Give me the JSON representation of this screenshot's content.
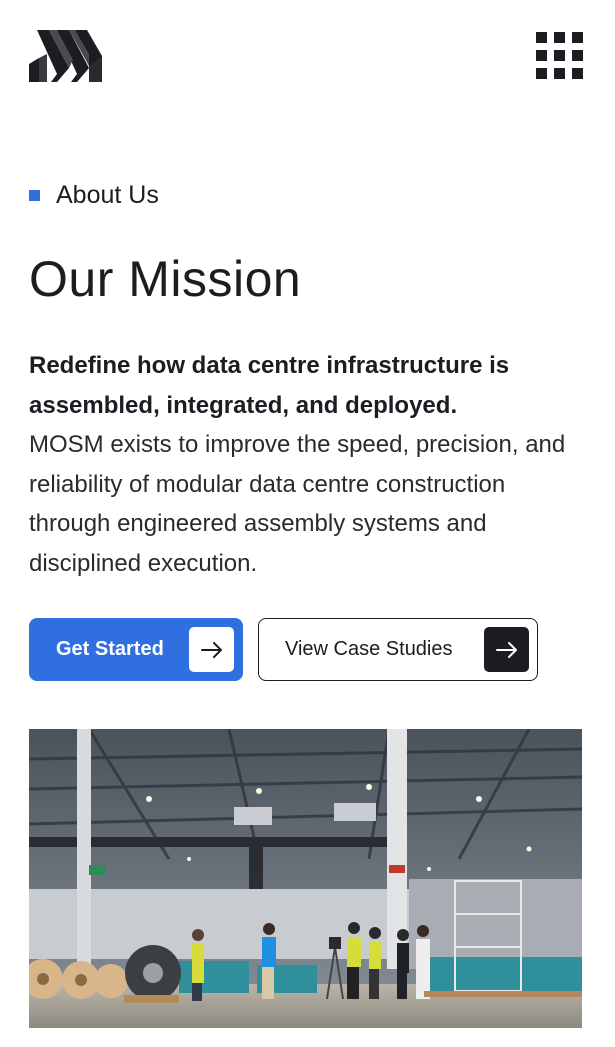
{
  "header": {
    "logo_name": "MOSM logo",
    "menu_icon": "grid-menu-icon"
  },
  "section": {
    "eyebrow": "About Us",
    "title": "Our Mission",
    "lead": "Redefine how data centre infrastructure is assembled, integrated, and deployed.",
    "body": "MOSM exists to improve the speed, precision, and reliability of modular data centre construction through engineered assembly systems and disciplined execution."
  },
  "buttons": {
    "primary_label": "Get Started",
    "secondary_label": "View Case Studies",
    "arrow_icon": "arrow-right-icon"
  },
  "image": {
    "subject": "warehouse-team-photo"
  },
  "colors": {
    "accent": "#2f6fe0",
    "dark": "#1c1c22",
    "background": "#ffffff"
  }
}
